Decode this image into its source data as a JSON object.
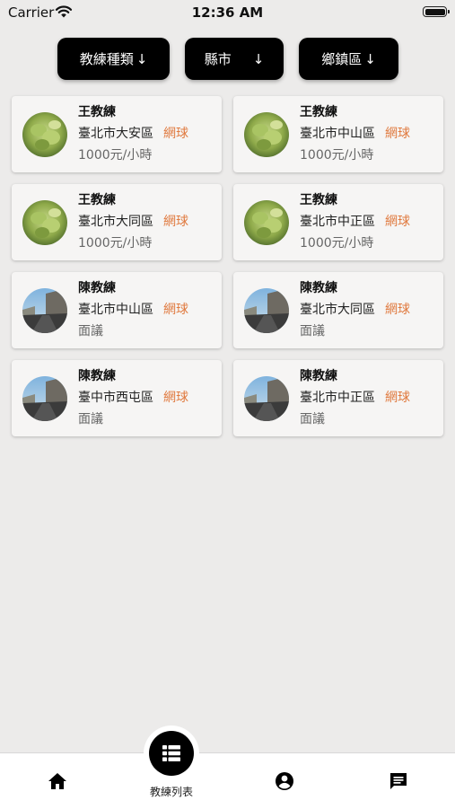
{
  "status": {
    "carrier": "Carrier",
    "time": "12:36 AM"
  },
  "filters": [
    {
      "label": "教練種類",
      "arrow": "↓"
    },
    {
      "label": "縣市",
      "arrow": "↓"
    },
    {
      "label": "鄉鎮區",
      "arrow": "↓"
    }
  ],
  "coaches": [
    {
      "name": "王教練",
      "location": "臺北市大安區",
      "sport": "網球",
      "price": "1000元/小時",
      "avatar": "leaf-photo"
    },
    {
      "name": "王教練",
      "location": "臺北市中山區",
      "sport": "網球",
      "price": "1000元/小時",
      "avatar": "leaf-photo"
    },
    {
      "name": "王教練",
      "location": "臺北市大同區",
      "sport": "網球",
      "price": "1000元/小時",
      "avatar": "leaf-photo"
    },
    {
      "name": "王教練",
      "location": "臺北市中正區",
      "sport": "網球",
      "price": "1000元/小時",
      "avatar": "leaf-photo"
    },
    {
      "name": "陳教練",
      "location": "臺北市中山區",
      "sport": "網球",
      "price": "面議",
      "avatar": "street-photo"
    },
    {
      "name": "陳教練",
      "location": "臺北市大同區",
      "sport": "網球",
      "price": "面議",
      "avatar": "street-photo"
    },
    {
      "name": "陳教練",
      "location": "臺中市西屯區",
      "sport": "網球",
      "price": "面議",
      "avatar": "street-photo"
    },
    {
      "name": "陳教練",
      "location": "臺北市中正區",
      "sport": "網球",
      "price": "面議",
      "avatar": "street-photo"
    }
  ],
  "tabbar": {
    "center_label": "教練列表",
    "icons": [
      "home-icon",
      "list-icon",
      "account-icon",
      "chat-icon"
    ]
  },
  "colors": {
    "accent": "#e07a3f",
    "filter_bg": "#000000",
    "background": "#ecebea",
    "card_bg": "#f6f5f4"
  }
}
